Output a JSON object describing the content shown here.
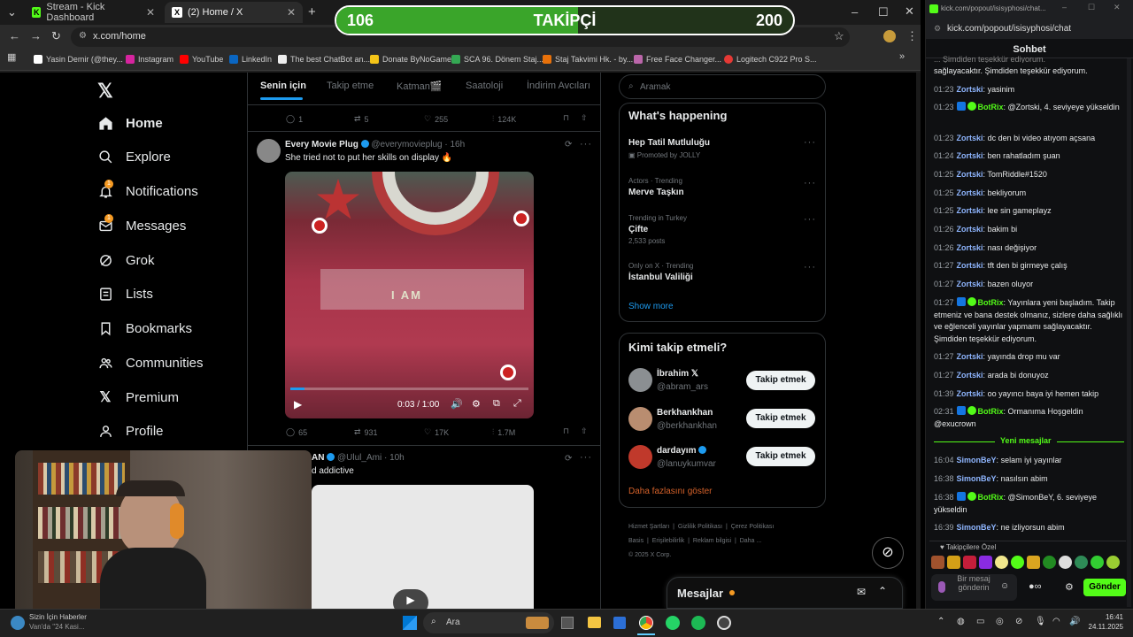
{
  "follower_bar": {
    "current": "106",
    "label": "TAKİPÇİ",
    "goal": "200",
    "progress": 0.53
  },
  "browser": {
    "tabs": [
      {
        "title": "Stream - Kick Dashboard"
      },
      {
        "title": "(2) Home / X"
      }
    ],
    "url": "x.com/home",
    "bookmarks": [
      "Yasin Demir (@they...",
      "Instagram",
      "YouTube",
      "LinkedIn",
      "The best ChatBot an...",
      "Donate ByNoGame",
      "SCA 96. Dönem Staj...",
      "Staj Takvimi Hk. - by...",
      "Free Face Changer...",
      "Logitech C922 Pro S..."
    ]
  },
  "sidebar": {
    "items": [
      {
        "label": "Home",
        "icon": "home-icon"
      },
      {
        "label": "Explore",
        "icon": "search-icon"
      },
      {
        "label": "Notifications",
        "icon": "bell-icon",
        "badge": "1"
      },
      {
        "label": "Messages",
        "icon": "mail-icon",
        "badge": "1"
      },
      {
        "label": "Grok",
        "icon": "grok-icon"
      },
      {
        "label": "Lists",
        "icon": "list-icon"
      },
      {
        "label": "Bookmarks",
        "icon": "bookmark-icon"
      },
      {
        "label": "Communities",
        "icon": "people-icon"
      },
      {
        "label": "Premium",
        "icon": "x-icon"
      },
      {
        "label": "Profile",
        "icon": "person-icon"
      }
    ]
  },
  "feed": {
    "tabs": [
      "Senin için",
      "Takip etme",
      "Katman🎬",
      "Saatoloji",
      "İndirim Avcıları"
    ],
    "prev_actions": {
      "replies": "1",
      "reposts": "5",
      "likes": "255",
      "views": "124K"
    },
    "post": {
      "name": "Every Movie Plug",
      "handle": "@everymovieplug · 16h",
      "text": "She tried not to put her skills on display 🔥",
      "video_time": "0:03 / 1:00",
      "overlay_text": "I AM",
      "replies": "65",
      "reposts": "931",
      "likes": "17K",
      "views": "1.7M"
    },
    "post2": {
      "name": "AN",
      "handle": "@Ulul_Ami · 10h",
      "text": "d addictive"
    }
  },
  "right": {
    "search_placeholder": "Aramak",
    "happening_title": "What's happening",
    "trends": [
      {
        "meta": "",
        "title": "Hep Tatil Mutluluğu",
        "sub": "Promoted by JOLLY"
      },
      {
        "meta": "Actors · Trending",
        "title": "Merve Taşkın",
        "sub": ""
      },
      {
        "meta": "Trending in Turkey",
        "title": "Çifte",
        "sub": "2,533 posts"
      },
      {
        "meta": "Only on X · Trending",
        "title": "İstanbul Valiliği",
        "sub": ""
      }
    ],
    "show_more": "Show more",
    "who_title": "Kimi takip etmeli?",
    "who": [
      {
        "name": "İbrahim 𝕏",
        "handle": "@abram_ars",
        "btn": "Takip etmek"
      },
      {
        "name": "Berkhankhan",
        "handle": "@berkhankhan",
        "btn": "Takip etmek"
      },
      {
        "name": "dardayım",
        "handle": "@lanuykumvar",
        "btn": "Takip etmek"
      }
    ],
    "who_more": "Daha fazlasını göster",
    "footer": [
      "Hizmet Şartları",
      "Gizlilik Politikası",
      "Çerez Politikası",
      "Basis",
      "Erişilebilirlik",
      "Reklam bilgisi",
      "Daha ...",
      "© 2025 X Corp."
    ],
    "messages_label": "Mesajlar"
  },
  "kick": {
    "window_url": "kick.com/popout/isisyphosi/chat...",
    "url": "kick.com/popout/isisyphosi/chat",
    "title": "Sohbet",
    "top_partial": "sağlayacaktır. Şimdiden teşekkür ediyorum.",
    "messages": [
      {
        "time": "01:23",
        "user": "Zortski",
        "text": "yasinim",
        "bot": false
      },
      {
        "time": "01:23",
        "user": "BotRix",
        "text": "@Zortski, 4. seviyeye yükseldin",
        "bot": true
      },
      {
        "time": "01:23",
        "user": "Zortski",
        "text": "dc den bi video atıyom açsana",
        "bot": false
      },
      {
        "time": "01:24",
        "user": "Zortski",
        "text": "ben rahatladım şuan",
        "bot": false
      },
      {
        "time": "01:25",
        "user": "Zortski",
        "text": "TomRiddle#1520",
        "bot": false
      },
      {
        "time": "01:25",
        "user": "Zortski",
        "text": "bekliyorum",
        "bot": false
      },
      {
        "time": "01:25",
        "user": "Zortski",
        "text": "lee sin gameplayz",
        "bot": false
      },
      {
        "time": "01:26",
        "user": "Zortski",
        "text": "bakim bi",
        "bot": false
      },
      {
        "time": "01:26",
        "user": "Zortski",
        "text": "nası değişiyor",
        "bot": false
      },
      {
        "time": "01:27",
        "user": "Zortski",
        "text": "tft den bi girmeye çalış",
        "bot": false
      },
      {
        "time": "01:27",
        "user": "Zortski",
        "text": "bazen oluyor",
        "bot": false
      },
      {
        "time": "01:27",
        "user": "BotRix",
        "text": "Yayınlara yeni başladım. Takip etmeniz ve bana destek olmanız, sizlere daha sağlıklı ve eğlenceli yayınlar yapmamı sağlayacaktır. Şimdiden teşekkür ediyorum.",
        "bot": true
      },
      {
        "time": "01:27",
        "user": "Zortski",
        "text": "yayında drop mu var",
        "bot": false
      },
      {
        "time": "01:27",
        "user": "Zortski",
        "text": "arada bi donuyoz",
        "bot": false
      },
      {
        "time": "01:39",
        "user": "Zortski",
        "text": "oo yayıncı baya iyi hemen takip",
        "bot": false
      },
      {
        "time": "02:31",
        "user": "BotRix",
        "text": "Ormanıma Hoşgeldin @exucrown",
        "bot": true
      }
    ],
    "new_label": "Yeni mesajlar",
    "new_messages": [
      {
        "time": "16:04",
        "user": "SimonBeY",
        "text": "selam iyi yayınlar",
        "bot": false
      },
      {
        "time": "16:38",
        "user": "SimonBeY",
        "text": "nasılsın abim",
        "bot": false
      },
      {
        "time": "16:38",
        "user": "BotRix",
        "text": "@SimonBeY, 6. seviyeye yükseldin",
        "bot": true
      },
      {
        "time": "16:39",
        "user": "SimonBeY",
        "text": "ne izliyorsun abim",
        "bot": false
      }
    ],
    "emotes_label": "Takipçilere Özel",
    "input_placeholder": "Bir mesaj gönderin",
    "send": "Gönder"
  },
  "taskbar": {
    "news_title": "Sizin İçin Haberler",
    "news_sub": "Van'da \"24 Kasi...",
    "search": "Ara",
    "time": "16:41",
    "date": "24.11.2025"
  }
}
